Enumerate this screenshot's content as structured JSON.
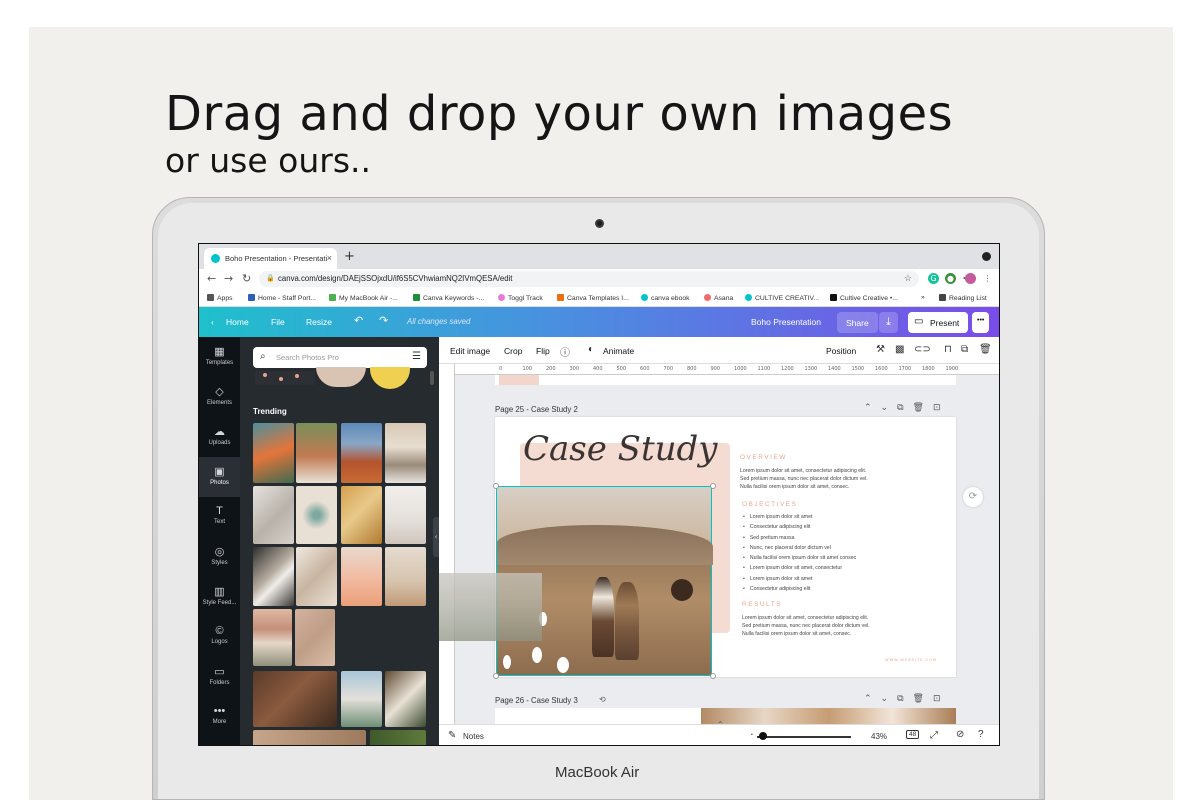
{
  "headline": "Drag and drop your own images",
  "subheadline": "or use ours..",
  "device_label": "MacBook Air",
  "browser": {
    "tab_title": "Boho Presentation - Presentati",
    "tab_close": "×",
    "new_tab": "+",
    "url": "canva.com/design/DAEjSSOjxdU/if6S5CVhwiamNQ2IVmQESA/edit",
    "bookmarks": [
      {
        "label": "Apps",
        "color": "#555"
      },
      {
        "label": "Home - Staff Port...",
        "color": "#2b5fb8"
      },
      {
        "label": "My MacBook Air -...",
        "color": "#4caf50"
      },
      {
        "label": "Canva Keywords -...",
        "color": "#1e8e3e"
      },
      {
        "label": "Toggl Track",
        "color": "#e57cd8"
      },
      {
        "label": "Canva Templates I...",
        "color": "#e8710a"
      },
      {
        "label": "canva ebook",
        "color": "#00c4cc"
      },
      {
        "label": "Asana",
        "color": "#f06a6a"
      },
      {
        "label": "CULTIVE CREATIV...",
        "color": "#00c4cc"
      },
      {
        "label": "Cultive Creative •...",
        "color": "#111"
      }
    ],
    "bookmarks_more": "»",
    "reading_list": "Reading List"
  },
  "canva_header": {
    "home": "Home",
    "file": "File",
    "resize": "Resize",
    "saved": "All changes saved",
    "doc_title": "Boho Presentation",
    "share": "Share",
    "present": "Present",
    "more": "•••"
  },
  "rail": [
    {
      "label": "Templates",
      "icon": "▦"
    },
    {
      "label": "Elements",
      "icon": "◇"
    },
    {
      "label": "Uploads",
      "icon": "☁"
    },
    {
      "label": "Photos",
      "icon": "▣"
    },
    {
      "label": "Text",
      "icon": "T"
    },
    {
      "label": "Styles",
      "icon": "◎"
    },
    {
      "label": "Style Feed...",
      "icon": "▥"
    },
    {
      "label": "Logos",
      "icon": "©"
    },
    {
      "label": "Folders",
      "icon": "▭"
    },
    {
      "label": "More",
      "icon": "•••"
    }
  ],
  "panel": {
    "search_placeholder": "Search Photos Pro",
    "trending": "Trending"
  },
  "toolbar": {
    "edit_image": "Edit image",
    "crop": "Crop",
    "flip": "Flip",
    "animate": "Animate",
    "position": "Position"
  },
  "ruler_ticks": [
    "0",
    "100",
    "200",
    "300",
    "400",
    "500",
    "600",
    "700",
    "800",
    "900",
    "1000",
    "1100",
    "1200",
    "1300",
    "1400",
    "1500",
    "1600",
    "1700",
    "1800",
    "1900"
  ],
  "page25": {
    "label": "Page 25 - Case Study 2",
    "title": "Case Study",
    "overview_h": "OVERVIEW",
    "overview_p": [
      "Lorem ipsum dolor sit amet, consectetur adipiscing elit.",
      "Sed pretium massa, nunc nec placerat dolor dictum vel.",
      "Nulla facilisi orem ipsum dolor sit amet, consec."
    ],
    "objectives_h": "OBJECTIVES",
    "objectives": [
      "Lorem ipsum dolor sit amet",
      "Consectetur adipiscing elit",
      "Sed pretium massa",
      "Nunc, nec placerat dolor dictum vel",
      "Nulla facilisi orem ipsum dolor sit amet consec",
      "Lorem ipsum dolor sit amet, consectetur",
      "Lorem ipsum dolor sit amet",
      "Consectetur adipiscing elit"
    ],
    "results_h": "RESULTS",
    "results_p": [
      "Lorem ipsum dolor sit amet, consectetur adipiscing elit.",
      "Sed pretium massa, nunc nec placerat dolor dictum vel.",
      "Nulla facilisi orem ipsum dolor sit amet, consec."
    ],
    "footer_url": "WWW.WEBSITE.COM"
  },
  "page26": {
    "label": "Page 26 - Case Study 3"
  },
  "bottom": {
    "notes": "Notes",
    "zoom": "43%",
    "page_count": "48"
  }
}
